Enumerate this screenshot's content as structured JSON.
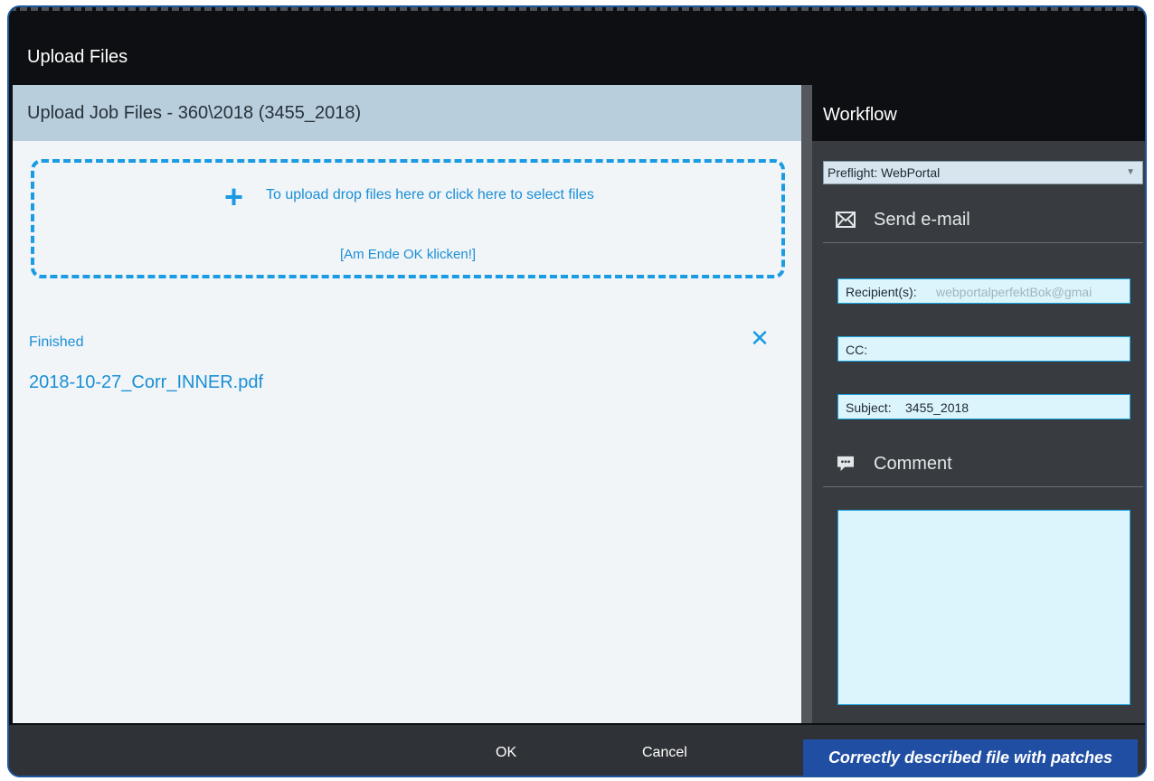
{
  "window": {
    "title": "Upload Files"
  },
  "left": {
    "header": "Upload Job Files - 360\\2018 (3455_2018)",
    "dropzone": {
      "icon": "plus-icon",
      "message": "To upload drop files here or click here to select files",
      "hint": "[Am Ende OK klicken!]"
    },
    "file": {
      "status": "Finished",
      "name": "2018-10-27_Corr_INNER.pdf",
      "remove_icon": "close-icon"
    }
  },
  "right": {
    "header": "Workflow",
    "preflight": {
      "label": "Preflight:",
      "value": "WebPortal"
    },
    "email_section": {
      "icon": "envelope-icon",
      "label": "Send e-mail"
    },
    "recipients": {
      "label": "Recipient(s):",
      "placeholder": "webportalperfektBok@gmai"
    },
    "cc": {
      "label": "CC:",
      "value": ""
    },
    "subject": {
      "label": "Subject:",
      "value": "3455_2018"
    },
    "comment_section": {
      "icon": "comment-icon",
      "label": "Comment"
    },
    "comment": {
      "value": ""
    }
  },
  "footer": {
    "ok_label": "OK",
    "cancel_label": "Cancel",
    "banner": "Correctly described file with patches"
  },
  "colors": {
    "accent": "#1a9be3",
    "title_bg": "#0d0f12",
    "header_bg": "#b8cedd",
    "banner_bg": "#1f4ea3"
  }
}
